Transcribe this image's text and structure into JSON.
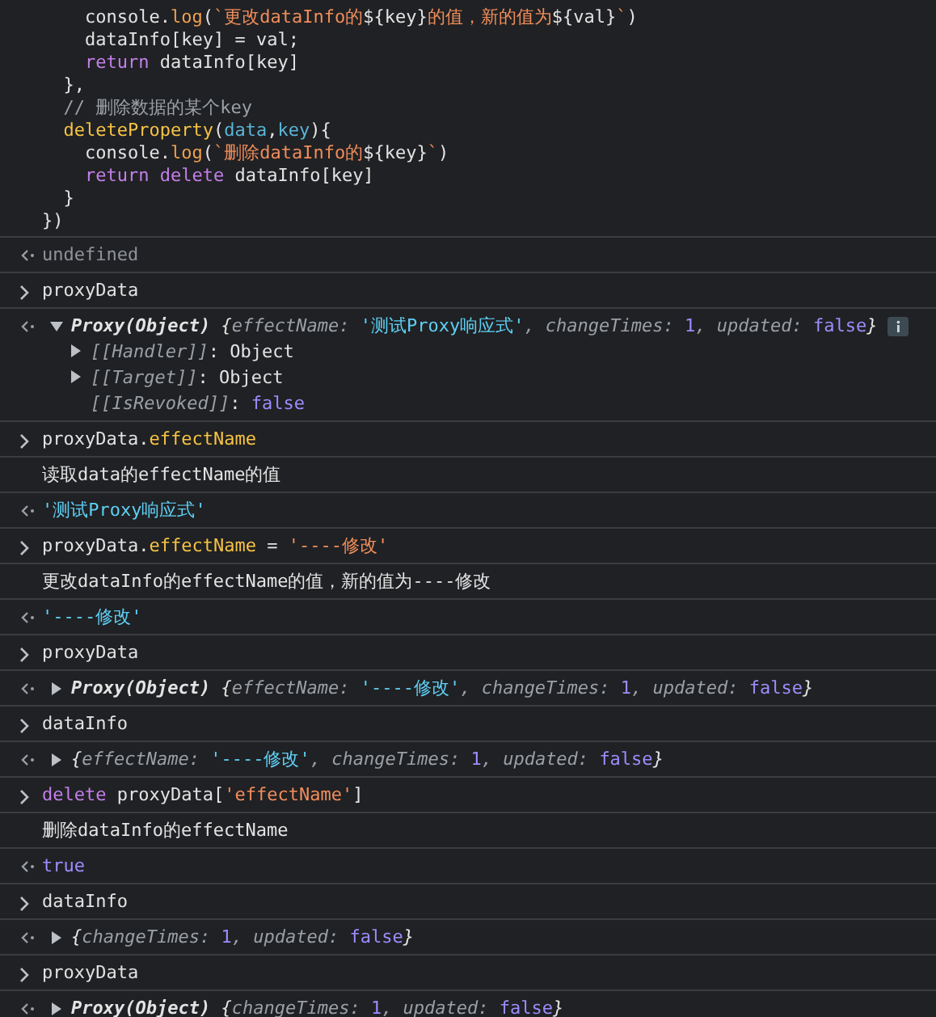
{
  "entries": [
    {
      "kind": "continuation",
      "lines": [
        [
          {
            "kind": "plain",
            "text": "    console."
          },
          {
            "kind": "method",
            "text": "log"
          },
          {
            "kind": "plain",
            "text": "("
          },
          {
            "kind": "string",
            "text": "`更改dataInfo的"
          },
          {
            "kind": "plain",
            "text": "${key}"
          },
          {
            "kind": "string",
            "text": "的值，新的值为"
          },
          {
            "kind": "plain",
            "text": "${val}"
          },
          {
            "kind": "string",
            "text": "`"
          },
          {
            "kind": "plain",
            "text": ")"
          }
        ],
        [
          {
            "kind": "plain",
            "text": "    dataInfo[key] = val;"
          }
        ],
        [
          {
            "kind": "keyword",
            "text": "    return"
          },
          {
            "kind": "plain",
            "text": " dataInfo[key]"
          }
        ],
        [
          {
            "kind": "plain",
            "text": "  },"
          }
        ],
        [
          {
            "kind": "comment",
            "text": "  // 删除数据的某个key"
          }
        ],
        [
          {
            "kind": "function",
            "text": "  deleteProperty"
          },
          {
            "kind": "plain",
            "text": "("
          },
          {
            "kind": "param",
            "text": "data"
          },
          {
            "kind": "plain",
            "text": ","
          },
          {
            "kind": "param",
            "text": "key"
          },
          {
            "kind": "plain",
            "text": "){"
          }
        ],
        [
          {
            "kind": "plain",
            "text": "    console."
          },
          {
            "kind": "method",
            "text": "log"
          },
          {
            "kind": "plain",
            "text": "("
          },
          {
            "kind": "string",
            "text": "`删除dataInfo的"
          },
          {
            "kind": "plain",
            "text": "${key}"
          },
          {
            "kind": "string",
            "text": "`"
          },
          {
            "kind": "plain",
            "text": ")"
          }
        ],
        [
          {
            "kind": "keyword",
            "text": "    return delete"
          },
          {
            "kind": "plain",
            "text": " dataInfo[key]"
          }
        ],
        [
          {
            "kind": "plain",
            "text": "  }"
          }
        ],
        [
          {
            "kind": "plain",
            "text": "})"
          }
        ]
      ]
    },
    {
      "kind": "result",
      "lines": [
        [
          {
            "kind": "undefined",
            "text": "undefined"
          }
        ]
      ]
    },
    {
      "kind": "input",
      "lines": [
        [
          {
            "kind": "plain",
            "text": "proxyData"
          }
        ]
      ]
    },
    {
      "kind": "result",
      "expanded": true,
      "info": true,
      "lines": [
        [
          {
            "kind": "class",
            "text": "Proxy(Object) "
          },
          {
            "kind": "brace",
            "text": "{"
          },
          {
            "kind": "key",
            "text": "effectName: "
          },
          {
            "kind": "value",
            "text": "'测试Proxy响应式'"
          },
          {
            "kind": "key",
            "text": ", changeTimes: "
          },
          {
            "kind": "number",
            "text": "1"
          },
          {
            "kind": "key",
            "text": ", updated: "
          },
          {
            "kind": "number",
            "text": "false"
          },
          {
            "kind": "brace",
            "text": "}"
          }
        ]
      ],
      "children": [
        {
          "expanded": false,
          "line": [
            {
              "kind": "key",
              "text": "[[Handler]]"
            },
            {
              "kind": "plain",
              "text": ": Object"
            }
          ]
        },
        {
          "expanded": false,
          "line": [
            {
              "kind": "key",
              "text": "[[Target]]"
            },
            {
              "kind": "plain",
              "text": ": Object"
            }
          ]
        },
        {
          "line": [
            {
              "kind": "key",
              "text": "[[IsRevoked]]"
            },
            {
              "kind": "plain",
              "text": ": "
            },
            {
              "kind": "number",
              "text": "false"
            }
          ]
        }
      ]
    },
    {
      "kind": "input",
      "lines": [
        [
          {
            "kind": "plain",
            "text": "proxyData."
          },
          {
            "kind": "function",
            "text": "effectName"
          }
        ]
      ]
    },
    {
      "kind": "log",
      "lines": [
        [
          {
            "kind": "plain",
            "text": "读取data的effectName的值"
          }
        ]
      ]
    },
    {
      "kind": "result",
      "lines": [
        [
          {
            "kind": "value",
            "text": "'测试Proxy响应式'"
          }
        ]
      ]
    },
    {
      "kind": "input",
      "lines": [
        [
          {
            "kind": "plain",
            "text": "proxyData."
          },
          {
            "kind": "function",
            "text": "effectName"
          },
          {
            "kind": "plain",
            "text": " = "
          },
          {
            "kind": "string",
            "text": "'----修改'"
          }
        ]
      ]
    },
    {
      "kind": "log",
      "lines": [
        [
          {
            "kind": "plain",
            "text": "更改dataInfo的effectName的值，新的值为----修改"
          }
        ]
      ]
    },
    {
      "kind": "result",
      "lines": [
        [
          {
            "kind": "value",
            "text": "'----修改'"
          }
        ]
      ]
    },
    {
      "kind": "input",
      "lines": [
        [
          {
            "kind": "plain",
            "text": "proxyData"
          }
        ]
      ]
    },
    {
      "kind": "result",
      "expanded": false,
      "lines": [
        [
          {
            "kind": "class",
            "text": "Proxy(Object) "
          },
          {
            "kind": "brace",
            "text": "{"
          },
          {
            "kind": "key",
            "text": "effectName: "
          },
          {
            "kind": "value",
            "text": "'----修改'"
          },
          {
            "kind": "key",
            "text": ", changeTimes: "
          },
          {
            "kind": "number",
            "text": "1"
          },
          {
            "kind": "key",
            "text": ", updated: "
          },
          {
            "kind": "number",
            "text": "false"
          },
          {
            "kind": "brace",
            "text": "}"
          }
        ]
      ]
    },
    {
      "kind": "input",
      "lines": [
        [
          {
            "kind": "plain",
            "text": "dataInfo"
          }
        ]
      ]
    },
    {
      "kind": "result",
      "expanded": false,
      "lines": [
        [
          {
            "kind": "brace",
            "text": "{"
          },
          {
            "kind": "key",
            "text": "effectName: "
          },
          {
            "kind": "value",
            "text": "'----修改'"
          },
          {
            "kind": "key",
            "text": ", changeTimes: "
          },
          {
            "kind": "number",
            "text": "1"
          },
          {
            "kind": "key",
            "text": ", updated: "
          },
          {
            "kind": "number",
            "text": "false"
          },
          {
            "kind": "brace",
            "text": "}"
          }
        ]
      ]
    },
    {
      "kind": "input",
      "lines": [
        [
          {
            "kind": "keyword",
            "text": "delete"
          },
          {
            "kind": "plain",
            "text": " proxyData["
          },
          {
            "kind": "string",
            "text": "'effectName'"
          },
          {
            "kind": "plain",
            "text": "]"
          }
        ]
      ]
    },
    {
      "kind": "log",
      "lines": [
        [
          {
            "kind": "plain",
            "text": "删除dataInfo的effectName"
          }
        ]
      ]
    },
    {
      "kind": "result",
      "lines": [
        [
          {
            "kind": "number",
            "text": "true"
          }
        ]
      ]
    },
    {
      "kind": "input",
      "lines": [
        [
          {
            "kind": "plain",
            "text": "dataInfo"
          }
        ]
      ]
    },
    {
      "kind": "result",
      "expanded": false,
      "lines": [
        [
          {
            "kind": "brace",
            "text": "{"
          },
          {
            "kind": "key",
            "text": "changeTimes: "
          },
          {
            "kind": "number",
            "text": "1"
          },
          {
            "kind": "key",
            "text": ", updated: "
          },
          {
            "kind": "number",
            "text": "false"
          },
          {
            "kind": "brace",
            "text": "}"
          }
        ]
      ]
    },
    {
      "kind": "input",
      "lines": [
        [
          {
            "kind": "plain",
            "text": "proxyData"
          }
        ]
      ]
    },
    {
      "kind": "result",
      "expanded": false,
      "lines": [
        [
          {
            "kind": "class",
            "text": "Proxy(Object) "
          },
          {
            "kind": "brace",
            "text": "{"
          },
          {
            "kind": "key",
            "text": "changeTimes: "
          },
          {
            "kind": "number",
            "text": "1"
          },
          {
            "kind": "key",
            "text": ", updated: "
          },
          {
            "kind": "number",
            "text": "false"
          },
          {
            "kind": "brace",
            "text": "}"
          }
        ]
      ]
    }
  ]
}
